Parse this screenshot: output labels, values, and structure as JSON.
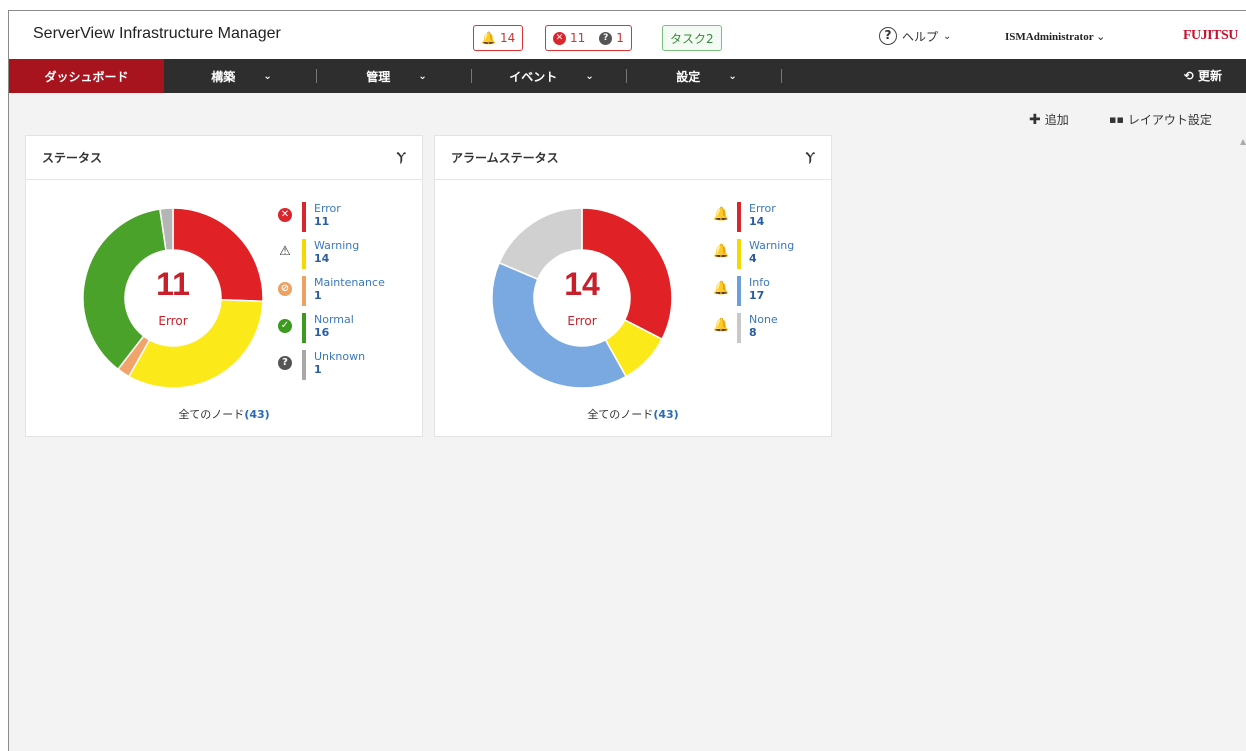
{
  "header": {
    "app_title": "ServerView Infrastructure Manager",
    "alarm_count": "14",
    "error_count": "11",
    "unknown_count": "1",
    "task_label": "タスク2",
    "help_label": "ヘルプ",
    "user_name": "ISMAdministrator",
    "brand": "FUJITSU"
  },
  "nav": {
    "dashboard": "ダッシュボード",
    "build": "構築",
    "manage": "管理",
    "event": "イベント",
    "settings": "設定",
    "refresh": "更新"
  },
  "toolbar": {
    "add_label": "追加",
    "layout_label": "レイアウト設定"
  },
  "status_widget": {
    "title": "ステータス",
    "center_value": "11",
    "center_label": "Error",
    "footer_prefix": "全てのノード",
    "footer_count": "(43)",
    "chart_data": {
      "type": "pie",
      "categories": [
        "Error",
        "Warning",
        "Maintenance",
        "Normal",
        "Unknown"
      ],
      "values": [
        11,
        14,
        1,
        16,
        1
      ],
      "colors": [
        "#e02226",
        "#fce91a",
        "#f2a36b",
        "#4aa22a",
        "#b5b5b5"
      ]
    },
    "legend": [
      {
        "name": "Error",
        "value": "11",
        "icon": "error-icon",
        "color": "#d9262c"
      },
      {
        "name": "Warning",
        "value": "14",
        "icon": "warning-icon",
        "color": "#f5d800"
      },
      {
        "name": "Maintenance",
        "value": "1",
        "icon": "maintenance-icon",
        "color": "#eca262"
      },
      {
        "name": "Normal",
        "value": "16",
        "icon": "normal-icon",
        "color": "#3b9a1f"
      },
      {
        "name": "Unknown",
        "value": "1",
        "icon": "unknown-icon",
        "color": "#a8a8a8"
      }
    ]
  },
  "alarm_widget": {
    "title": "アラームステータス",
    "center_value": "14",
    "center_label": "Error",
    "footer_prefix": "全てのノード",
    "footer_count": "(43)",
    "chart_data": {
      "type": "pie",
      "categories": [
        "Error",
        "Warning",
        "Info",
        "None"
      ],
      "values": [
        14,
        4,
        17,
        8
      ],
      "colors": [
        "#e02226",
        "#fce91a",
        "#79a9e0",
        "#d0d0d0"
      ]
    },
    "legend": [
      {
        "name": "Error",
        "value": "14",
        "icon": "bell-error-icon",
        "color": "#d9262c"
      },
      {
        "name": "Warning",
        "value": "4",
        "icon": "bell-warning-icon",
        "color": "#f5d800"
      },
      {
        "name": "Info",
        "value": "17",
        "icon": "bell-info-icon",
        "color": "#6d9fdc"
      },
      {
        "name": "None",
        "value": "8",
        "icon": "bell-none-icon",
        "color": "#c8c8c8"
      }
    ]
  }
}
